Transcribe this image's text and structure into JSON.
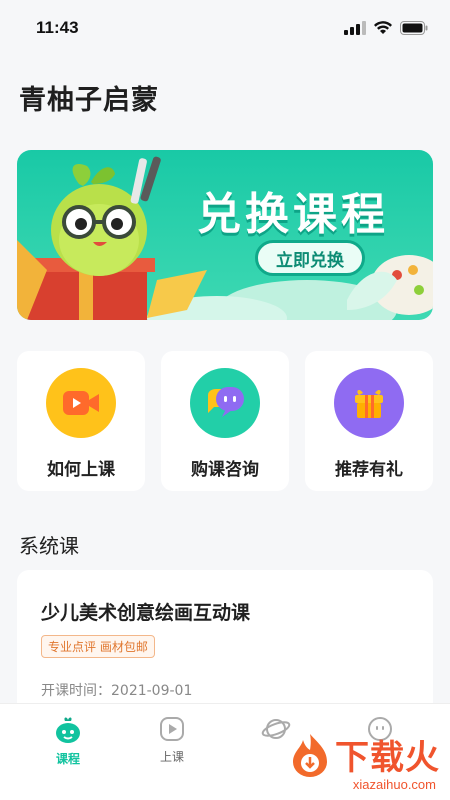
{
  "status_bar": {
    "time": "11:43"
  },
  "app_title": "青柚子启蒙",
  "banner": {
    "title": "兑换课程",
    "button_label": "立即兑换"
  },
  "quick_actions": [
    {
      "label": "如何上课",
      "icon": "video-play-icon",
      "color": "#ffc21a"
    },
    {
      "label": "购课咨询",
      "icon": "chat-bubble-icon",
      "color": "#22cfa8"
    },
    {
      "label": "推荐有礼",
      "icon": "gift-icon",
      "color": "#8f6bf2"
    }
  ],
  "section_title": "系统课",
  "course": {
    "title": "少儿美术创意绘画互动课",
    "tag": "专业点评 画材包邮",
    "start_date": "开课时间：2021-09-01"
  },
  "tabs": [
    {
      "label": "课程",
      "icon": "fruit-mascot-icon",
      "active": true
    },
    {
      "label": "上课",
      "icon": "play-icon",
      "active": false
    },
    {
      "label": "",
      "icon": "planet-icon",
      "active": false
    },
    {
      "label": "",
      "icon": "face-icon",
      "active": false
    }
  ],
  "watermark": {
    "text": "下载火",
    "domain": "xiazaihuo.com"
  },
  "colors": {
    "accent": "#11c39f",
    "banner": "#2fd2ad",
    "tag_orange": "#e0772f"
  }
}
